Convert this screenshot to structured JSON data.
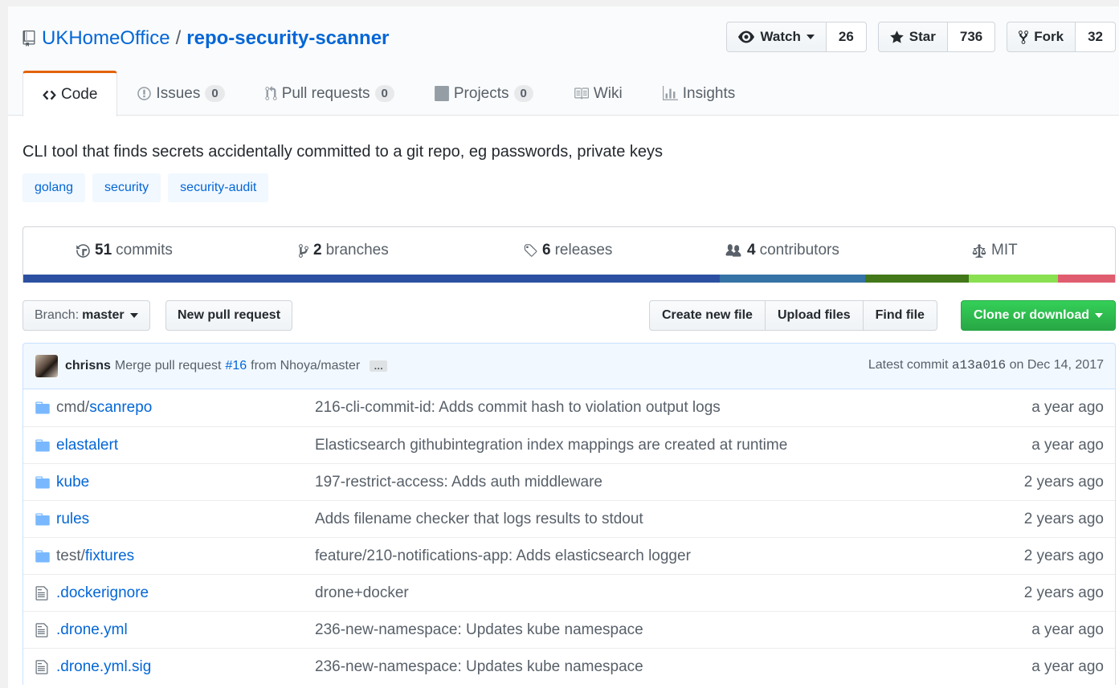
{
  "repo": {
    "owner": "UKHomeOffice",
    "separator": "/",
    "name": "repo-security-scanner"
  },
  "actions": {
    "watch_label": "Watch",
    "watch_count": "26",
    "star_label": "Star",
    "star_count": "736",
    "fork_label": "Fork",
    "fork_count": "32"
  },
  "tabs": [
    {
      "label": "Code",
      "counter": null
    },
    {
      "label": "Issues",
      "counter": "0"
    },
    {
      "label": "Pull requests",
      "counter": "0"
    },
    {
      "label": "Projects",
      "counter": "0"
    },
    {
      "label": "Wiki",
      "counter": null
    },
    {
      "label": "Insights",
      "counter": null
    }
  ],
  "description": "CLI tool that finds secrets accidentally committed to a git repo, eg passwords, private keys",
  "topics": [
    "golang",
    "security",
    "security-audit"
  ],
  "summary": {
    "commits_num": "51",
    "commits_label": "commits",
    "branches_num": "2",
    "branches_label": "branches",
    "releases_num": "6",
    "releases_label": "releases",
    "contributors_num": "4",
    "contributors_label": "contributors",
    "license": "MIT"
  },
  "language_bar": [
    {
      "color": "#2b50a1",
      "fraction": 0.638
    },
    {
      "color": "#3572a5",
      "fraction": 0.133
    },
    {
      "color": "#427819",
      "fraction": 0.095
    },
    {
      "color": "#89e051",
      "fraction": 0.082
    },
    {
      "color": "#e05d6f",
      "fraction": 0.052
    }
  ],
  "filebar": {
    "branch_prefix": "Branch:",
    "branch_name": "master",
    "new_pr": "New pull request",
    "create_file": "Create new file",
    "upload_files": "Upload files",
    "find_file": "Find file",
    "clone": "Clone or download"
  },
  "commit": {
    "author": "chrisns",
    "message_prefix": "Merge pull request",
    "pr_link": "#16",
    "message_suffix": "from Nhoya/master",
    "ellipsis": "…",
    "latest_label": "Latest commit",
    "sha": "a13a016",
    "date": "on Dec 14, 2017"
  },
  "files": [
    {
      "type": "dir",
      "prefix": "cmd/",
      "name": "scanrepo",
      "message": "216-cli-commit-id: Adds commit hash to violation output logs",
      "age": "a year ago"
    },
    {
      "type": "dir",
      "prefix": "",
      "name": "elastalert",
      "message": "Elasticsearch githubintegration index mappings are created at runtime",
      "age": "a year ago"
    },
    {
      "type": "dir",
      "prefix": "",
      "name": "kube",
      "message": "197-restrict-access: Adds auth middleware",
      "age": "2 years ago"
    },
    {
      "type": "dir",
      "prefix": "",
      "name": "rules",
      "message": "Adds filename checker that logs results to stdout",
      "age": "2 years ago"
    },
    {
      "type": "dir",
      "prefix": "test/",
      "name": "fixtures",
      "message": "feature/210-notifications-app: Adds elasticsearch logger",
      "age": "2 years ago"
    },
    {
      "type": "file",
      "prefix": "",
      "name": ".dockerignore",
      "message": "drone+docker",
      "age": "2 years ago"
    },
    {
      "type": "file",
      "prefix": "",
      "name": ".drone.yml",
      "message": "236-new-namespace: Updates kube namespace",
      "age": "a year ago"
    },
    {
      "type": "file",
      "prefix": "",
      "name": ".drone.yml.sig",
      "message": "236-new-namespace: Updates kube namespace",
      "age": "a year ago"
    }
  ]
}
